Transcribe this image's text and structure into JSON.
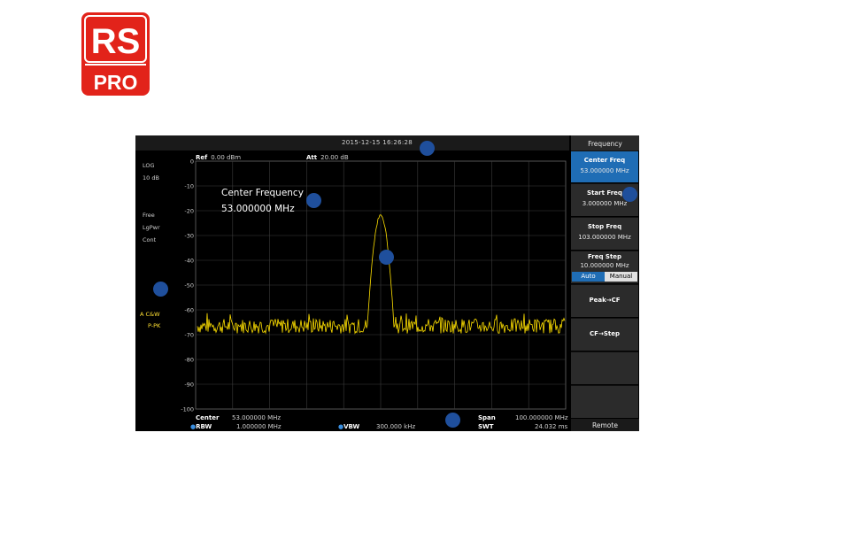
{
  "brand": {
    "top": "RS",
    "bottom": "PRO",
    "color": "#e2231a"
  },
  "status": {
    "datetime": "2015-12-15   16:26:28"
  },
  "ref": {
    "ref_key": "Ref",
    "ref_value": "0.00 dBm",
    "att_key": "Att",
    "att_value": "20.00 dB"
  },
  "left_panel": {
    "scale": "LOG",
    "div": "10 dB",
    "trig": "Free",
    "avg": "LgPwr",
    "sweep": "Cont",
    "trace_a": "A  C&W",
    "trace_detector": "P-PK"
  },
  "plot": {
    "y_ticks": [
      "0",
      "-10",
      "-20",
      "-30",
      "-40",
      "-50",
      "-60",
      "-70",
      "-80",
      "-90",
      "-100"
    ],
    "trace_color": "#ffe000",
    "noise_level_db": -66.5,
    "peak_db": -22
  },
  "marker": {
    "title": "Center Frequency",
    "value": "53.000000 MHz"
  },
  "bottom": {
    "center_key": "Center",
    "center_value": "53.000000 MHz",
    "span_key": "Span",
    "span_value": "100.000000 MHz",
    "rbw_key": "RBW",
    "rbw_value": "1.000000 MHz",
    "vbw_key": "VBW",
    "vbw_value": "300.000 kHz",
    "swt_key": "SWT",
    "swt_value": "24.032 ms"
  },
  "menu": {
    "title": "Frequency",
    "center_freq": {
      "label": "Center Freq",
      "value": "53.000000 MHz"
    },
    "start_freq": {
      "label": "Start Freq",
      "value": "3.000000 MHz"
    },
    "stop_freq": {
      "label": "Stop Freq",
      "value": "103.000000 MHz"
    },
    "freq_step": {
      "label": "Freq Step",
      "value": "10.000000 MHz",
      "auto": "Auto",
      "manual": "Manual"
    },
    "peak_cf": "Peak→CF",
    "cf_step": "CF→Step",
    "remote": "Remote"
  },
  "accent_color": "#1f6db5"
}
